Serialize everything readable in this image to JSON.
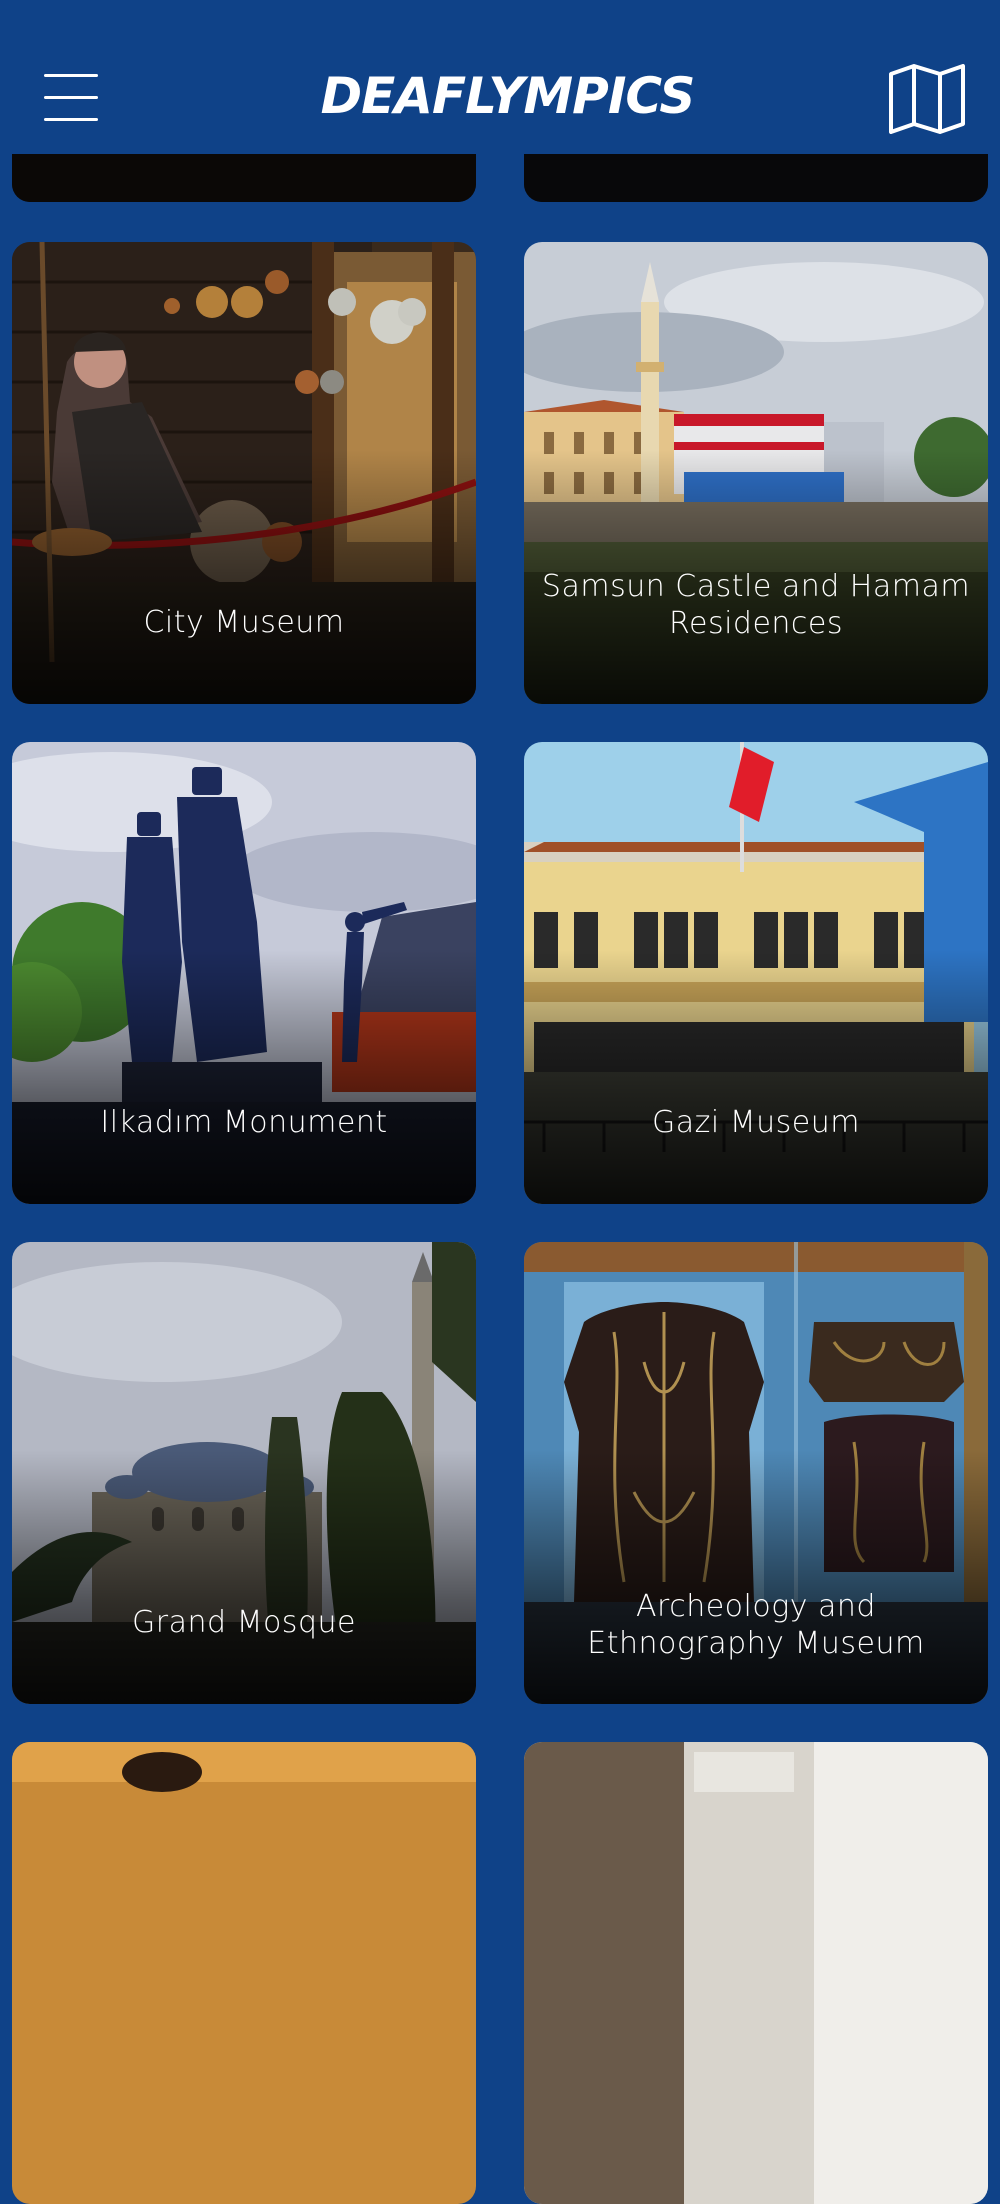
{
  "header": {
    "logo_text": "DEAFLYMPICS",
    "menu_icon": "hamburger-menu-icon",
    "map_icon": "map-icon",
    "background_color": "#0f4288"
  },
  "places": [
    {
      "name": "City Museum"
    },
    {
      "name": "Samsun Castle and Hamam Residences"
    },
    {
      "name": "Ilkadım Monument"
    },
    {
      "name": "Gazi Museum"
    },
    {
      "name": "Grand Mosque"
    },
    {
      "name": "Archeology and Ethnography Museum"
    }
  ]
}
